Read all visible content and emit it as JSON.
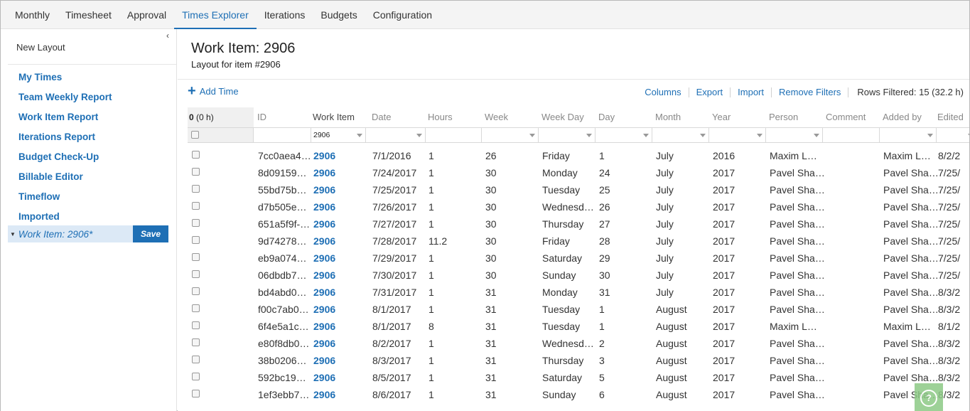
{
  "nav": {
    "tabs": [
      {
        "label": "Monthly"
      },
      {
        "label": "Timesheet"
      },
      {
        "label": "Approval"
      },
      {
        "label": "Times Explorer",
        "active": true
      },
      {
        "label": "Iterations"
      },
      {
        "label": "Budgets"
      },
      {
        "label": "Configuration"
      }
    ]
  },
  "sidebar": {
    "collapse_glyph": "‹",
    "new_layout": "New Layout",
    "items": [
      {
        "label": "My Times"
      },
      {
        "label": "Team Weekly Report"
      },
      {
        "label": "Work Item Report"
      },
      {
        "label": "Iterations Report"
      },
      {
        "label": "Budget Check-Up"
      },
      {
        "label": "Billable Editor"
      },
      {
        "label": "Timeflow"
      },
      {
        "label": "Imported"
      }
    ],
    "current": {
      "label": "Work Item: 2906*",
      "save_label": "Save"
    }
  },
  "main": {
    "title": "Work Item: 2906",
    "subtitle": "Layout for item #2906",
    "add_time": "Add Time",
    "actions": [
      "Columns",
      "Export",
      "Import",
      "Remove Filters"
    ],
    "rows_filtered": "Rows Filtered: 15 (32.2 h)"
  },
  "grid": {
    "summary_count": "0",
    "summary_hours": "(0 h)",
    "columns": [
      "ID",
      "Work Item",
      "Date",
      "Hours",
      "Week",
      "Week Day",
      "Day",
      "Month",
      "Year",
      "Person",
      "Comment",
      "Added by",
      "Edited"
    ],
    "work_item_filter": "2906",
    "rows": [
      [
        "7cc0aea4…",
        "2906",
        "7/1/2016",
        "1",
        "26",
        "Friday",
        "1",
        "July",
        "2016",
        "Maxim L…",
        "",
        "Maxim L…",
        "8/2/2"
      ],
      [
        "8d09159…",
        "2906",
        "7/24/2017",
        "1",
        "30",
        "Monday",
        "24",
        "July",
        "2017",
        "Pavel Sha…",
        "",
        "Pavel Sha…",
        "7/25/"
      ],
      [
        "55bd75b…",
        "2906",
        "7/25/2017",
        "1",
        "30",
        "Tuesday",
        "25",
        "July",
        "2017",
        "Pavel Sha…",
        "",
        "Pavel Sha…",
        "7/25/"
      ],
      [
        "d7b505e…",
        "2906",
        "7/26/2017",
        "1",
        "30",
        "Wednesd…",
        "26",
        "July",
        "2017",
        "Pavel Sha…",
        "",
        "Pavel Sha…",
        "7/25/"
      ],
      [
        "651a5f9f-…",
        "2906",
        "7/27/2017",
        "1",
        "30",
        "Thursday",
        "27",
        "July",
        "2017",
        "Pavel Sha…",
        "",
        "Pavel Sha…",
        "7/25/"
      ],
      [
        "9d74278…",
        "2906",
        "7/28/2017",
        "11.2",
        "30",
        "Friday",
        "28",
        "July",
        "2017",
        "Pavel Sha…",
        "",
        "Pavel Sha…",
        "7/25/"
      ],
      [
        "eb9a074…",
        "2906",
        "7/29/2017",
        "1",
        "30",
        "Saturday",
        "29",
        "July",
        "2017",
        "Pavel Sha…",
        "",
        "Pavel Sha…",
        "7/25/"
      ],
      [
        "06dbdb7…",
        "2906",
        "7/30/2017",
        "1",
        "30",
        "Sunday",
        "30",
        "July",
        "2017",
        "Pavel Sha…",
        "",
        "Pavel Sha…",
        "7/25/"
      ],
      [
        "bd4abd0…",
        "2906",
        "7/31/2017",
        "1",
        "31",
        "Monday",
        "31",
        "July",
        "2017",
        "Pavel Sha…",
        "",
        "Pavel Sha…",
        "8/3/2"
      ],
      [
        "f00c7ab0…",
        "2906",
        "8/1/2017",
        "1",
        "31",
        "Tuesday",
        "1",
        "August",
        "2017",
        "Pavel Sha…",
        "",
        "Pavel Sha…",
        "8/3/2"
      ],
      [
        "6f4e5a1c…",
        "2906",
        "8/1/2017",
        "8",
        "31",
        "Tuesday",
        "1",
        "August",
        "2017",
        "Maxim L…",
        "",
        "Maxim L…",
        "8/1/2"
      ],
      [
        "e80f8db0…",
        "2906",
        "8/2/2017",
        "1",
        "31",
        "Wednesd…",
        "2",
        "August",
        "2017",
        "Pavel Sha…",
        "",
        "Pavel Sha…",
        "8/3/2"
      ],
      [
        "38b0206…",
        "2906",
        "8/3/2017",
        "1",
        "31",
        "Thursday",
        "3",
        "August",
        "2017",
        "Pavel Sha…",
        "",
        "Pavel Sha…",
        "8/3/2"
      ],
      [
        "592bc19…",
        "2906",
        "8/5/2017",
        "1",
        "31",
        "Saturday",
        "5",
        "August",
        "2017",
        "Pavel Sha…",
        "",
        "Pavel Sha…",
        "8/3/2"
      ],
      [
        "1ef3ebb7…",
        "2906",
        "8/6/2017",
        "1",
        "31",
        "Sunday",
        "6",
        "August",
        "2017",
        "Pavel Sha…",
        "",
        "Pavel Sha…",
        "8/3/2"
      ]
    ]
  },
  "help": {
    "glyph": "?"
  }
}
